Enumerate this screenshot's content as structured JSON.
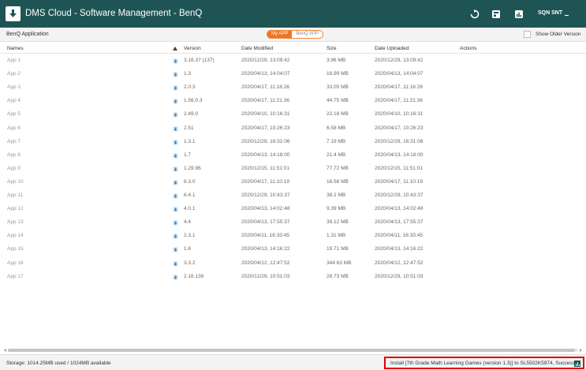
{
  "titlebar": {
    "title": "DMS Cloud - Software Management - BenQ",
    "user": "SQN SNT",
    "icons": [
      "download-logo-icon",
      "refresh-icon",
      "install-icon",
      "chart-icon"
    ]
  },
  "subheader": {
    "brand": "BenQ Application",
    "tabs": [
      {
        "label": "My APP",
        "active": true
      },
      {
        "label": "BenQ APP",
        "active": false
      }
    ],
    "show_older_label": "Show Older Version",
    "show_older_checked": false
  },
  "table": {
    "headers": {
      "names": "Names",
      "version": "Version",
      "date_modified": "Date Modified",
      "size": "Size",
      "date_uploaded": "Date Uploaded",
      "actions": "Actions"
    },
    "sort_column": "version",
    "sort_direction": "ascending",
    "rows": [
      {
        "name": "App 1",
        "version": "3.16.37 (137)",
        "modified": "2020/12/29, 13:09:42",
        "size": "3.96 MB",
        "uploaded": "2020/12/29, 13:09:42"
      },
      {
        "name": "App 2",
        "version": "1.3",
        "modified": "2020/04/13, 14:04:07",
        "size": "16.99 MB",
        "uploaded": "2020/04/13, 14:04:07"
      },
      {
        "name": "App 3",
        "version": "2.0.3",
        "modified": "2020/04/17, 11:16:26",
        "size": "33.05 MB",
        "uploaded": "2020/04/17, 11:16:26"
      },
      {
        "name": "App 4",
        "version": "1.56.0.3",
        "modified": "2020/04/17, 11:21:36",
        "size": "44.75 MB",
        "uploaded": "2020/04/17, 11:21:36"
      },
      {
        "name": "App 5",
        "version": "2.49.0",
        "modified": "2020/04/10, 10:16:31",
        "size": "22.18 MB",
        "uploaded": "2020/04/10, 10:16:31"
      },
      {
        "name": "App 6",
        "version": "2.51",
        "modified": "2020/04/17, 10:26:23",
        "size": "6.58 MB",
        "uploaded": "2020/04/17, 10:26:23"
      },
      {
        "name": "App 7",
        "version": "1.3.1",
        "modified": "2020/12/29, 16:31:06",
        "size": "7.19 MB",
        "uploaded": "2020/12/29, 16:31:06"
      },
      {
        "name": "App 8",
        "version": "1.7",
        "modified": "2020/04/13, 14:18:00",
        "size": "21.4 MB",
        "uploaded": "2020/04/13, 14:18:00"
      },
      {
        "name": "App 9",
        "version": "1.29.96",
        "modified": "2020/12/15, 11:51:01",
        "size": "77.72 MB",
        "uploaded": "2020/12/15, 11:51:01"
      },
      {
        "name": "App 10",
        "version": "8.3.0",
        "modified": "2020/04/17, 11:10:19",
        "size": "16.56 MB",
        "uploaded": "2020/04/17, 11:10:19"
      },
      {
        "name": "App 11",
        "version": "6.4.1",
        "modified": "2020/12/29, 10:43:37",
        "size": "38.2 MB",
        "uploaded": "2020/12/29, 10:43:37"
      },
      {
        "name": "App 12",
        "version": "4.0.1",
        "modified": "2020/04/13, 14:02:48",
        "size": "9.39 MB",
        "uploaded": "2020/04/13, 14:02:48"
      },
      {
        "name": "App 13",
        "version": "4.4",
        "modified": "2020/04/13, 17:55:37",
        "size": "39.12 MB",
        "uploaded": "2020/04/13, 17:55:37"
      },
      {
        "name": "App 14",
        "version": "2.3.1",
        "modified": "2020/04/11, 16:33:45",
        "size": "1.31 MB",
        "uploaded": "2020/04/11, 16:33:45"
      },
      {
        "name": "App 15",
        "version": "1.6",
        "modified": "2020/04/13, 14:16:22",
        "size": "19.71 MB",
        "uploaded": "2020/04/13, 14:16:22"
      },
      {
        "name": "App 16",
        "version": "3.3.2",
        "modified": "2020/04/12, 12:47:52",
        "size": "344.63 MB",
        "uploaded": "2020/04/12, 12:47:52"
      },
      {
        "name": "App 17",
        "version": "2.16.139",
        "modified": "2020/12/29, 10:51:03",
        "size": "28.73 MB",
        "uploaded": "2020/12/29, 10:51:03"
      }
    ]
  },
  "footer": {
    "storage": "Storage: 1014.25MB used / 1024MB available",
    "status": "Install [7th Grade Math Learning Games (version 1.3)] to SL5502K5974, Success"
  },
  "colors": {
    "titlebar_bg": "#1f5454",
    "accent_orange": "#f0741e",
    "highlight_red": "#e00000"
  }
}
